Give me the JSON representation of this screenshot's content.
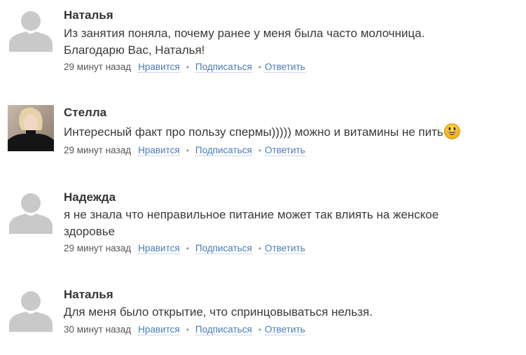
{
  "comments": [
    {
      "author": "Наталья",
      "avatar": "default-user-icon",
      "lines": [
        "Из занятия поняла, почему ранее у меня была часто молочница.",
        "Благодарю Вас, Наталья!"
      ],
      "time": "29 минут назад",
      "actions": [
        "Нравится",
        "Подписаться",
        "Ответить"
      ]
    },
    {
      "author": "Стелла",
      "avatar": "user-photo",
      "lines": [
        "Интересный факт про пользу спермы))))) можно и витамины не пить"
      ],
      "emoji": "grinning-face-emoji",
      "time": "29 минут назад",
      "actions": [
        "Нравится",
        "Подписаться",
        "Ответить"
      ]
    },
    {
      "author": "Надежда",
      "avatar": "default-user-icon",
      "lines": [
        "я не знала что неправильное питание может так влиять на женское",
        "здоровье"
      ],
      "time": "29 минут назад",
      "actions": [
        "Нравится",
        "Подписаться",
        "Ответить"
      ]
    },
    {
      "author": "Наталья",
      "avatar": "default-user-icon",
      "lines": [
        "Для меня было открытие, что спринцовываться нельзя."
      ],
      "time": "30 минут назад",
      "actions": [
        "Нравится",
        "Подписаться",
        "Ответить"
      ]
    }
  ],
  "separator": "•",
  "colors": {
    "link": "#4a7ab6",
    "avatar_placeholder": "#c9c9c9",
    "text": "#3a3a3a"
  }
}
